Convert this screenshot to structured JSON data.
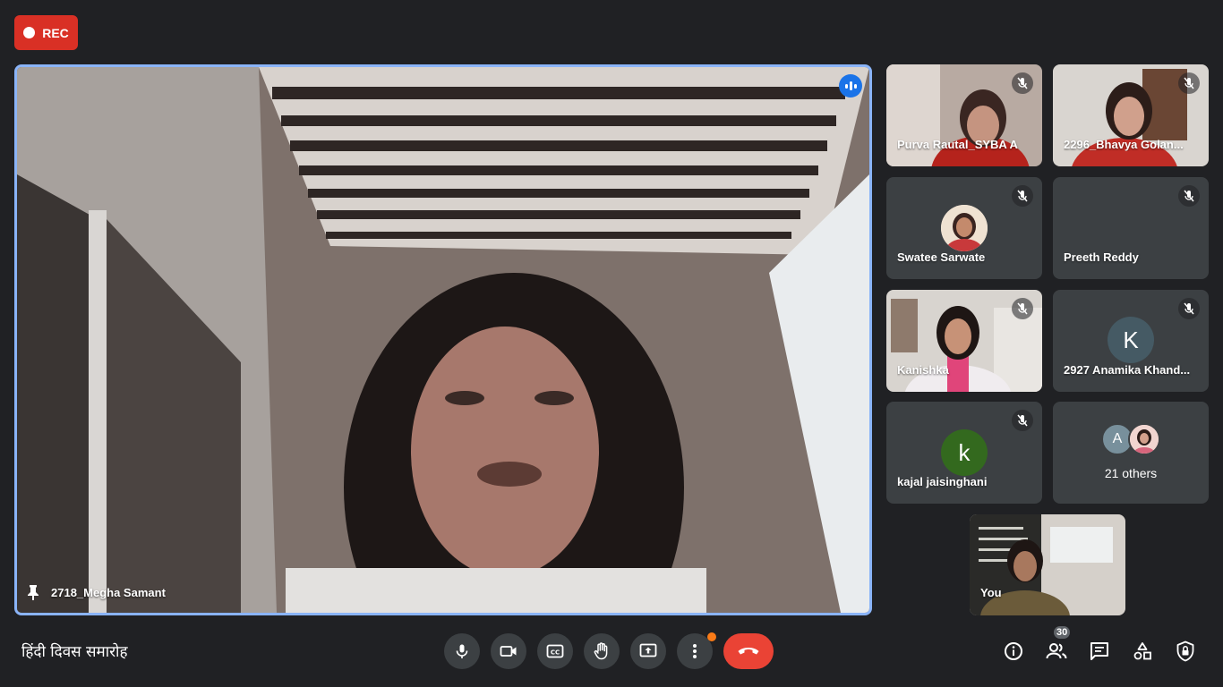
{
  "recording": {
    "label": "REC"
  },
  "main_participant": {
    "name": "2718_Megha Samant"
  },
  "participants": [
    {
      "name": "Purva Rautal_SYBA A"
    },
    {
      "name": "2296_Bhavya Golan..."
    },
    {
      "name": "Swatee Sarwate"
    },
    {
      "name": "Preeth Reddy"
    },
    {
      "name": "Kanishka"
    },
    {
      "name": "2927 Anamika Khand...",
      "initial": "K"
    },
    {
      "name": "kajal jaisinghani",
      "initial": "k"
    },
    {
      "others_initial": "A",
      "others_label": "21 others"
    }
  ],
  "self_tile": {
    "name": "You"
  },
  "meeting": {
    "title": "हिंदी दिवस समारोह"
  },
  "people": {
    "count": "30"
  },
  "icons": {
    "mic": "mic-icon",
    "camera": "camera-icon",
    "captions": "captions-icon",
    "hand": "raise-hand-icon",
    "present": "present-icon",
    "more": "more-vert-icon",
    "end": "call-end-icon",
    "info": "info-icon",
    "people": "people-icon",
    "chat": "chat-icon",
    "activities": "activities-icon",
    "host": "host-controls-icon",
    "pin": "pin-icon",
    "mic_off": "mic-off-icon"
  },
  "colors": {
    "background": "#202124",
    "tile": "#3c4043",
    "rec": "#d93025",
    "end_call": "#ea4335",
    "speaking_border": "#8ab4f8",
    "accent": "#1a73e8"
  }
}
